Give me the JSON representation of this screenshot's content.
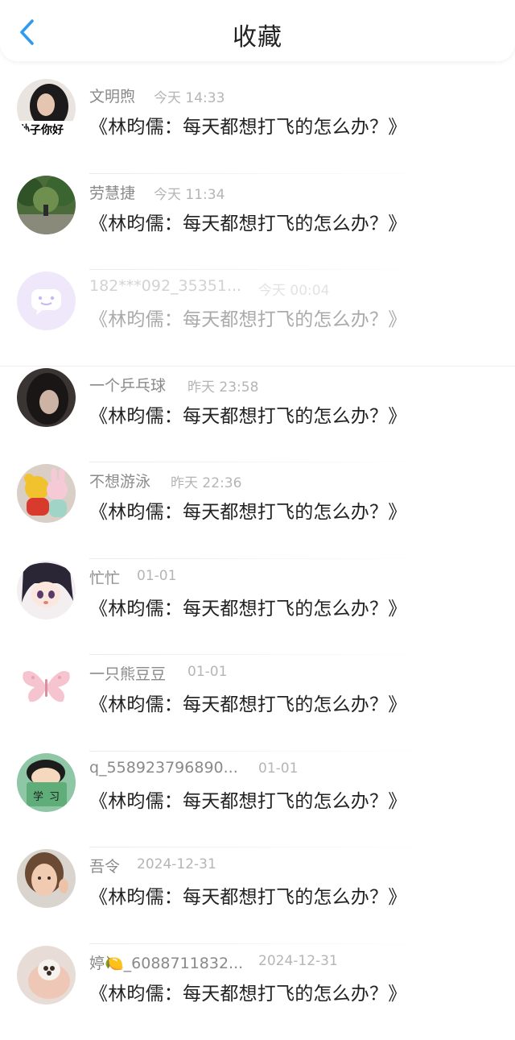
{
  "header": {
    "title": "收藏"
  },
  "messages": [
    {
      "name": "文明煦",
      "time": "今天 14:33",
      "content": "《林昀儒：每天都想打飞的怎么办？》",
      "avatar_icon": "woman-portrait-avatar"
    },
    {
      "name": "劳慧捷",
      "time": "今天 11:34",
      "content": "《林昀儒：每天都想打飞的怎么办？》",
      "avatar_icon": "forest-landscape-avatar"
    },
    {
      "name": "182***092_35351...",
      "time": "今天 00:04",
      "content": "《林昀儒：每天都想打飞的怎么办？》",
      "avatar_icon": "default-chat-bubble-avatar"
    },
    {
      "name": "一个乒乓球",
      "time": "昨天 23:58",
      "content": "《林昀儒：每天都想打飞的怎么办？》",
      "avatar_icon": "dark-portrait-avatar"
    },
    {
      "name": "不想游泳",
      "time": "昨天 22:36",
      "content": "《林昀儒：每天都想打飞的怎么办？》",
      "avatar_icon": "plush-toys-avatar"
    },
    {
      "name": "忙忙",
      "time": "01-01",
      "content": "《林昀儒：每天都想打飞的怎么办？》",
      "avatar_icon": "anime-girl-avatar"
    },
    {
      "name": "一只熊豆豆",
      "time": "01-01",
      "content": "《林昀儒：每天都想打飞的怎么办？》",
      "avatar_icon": "pink-butterfly-avatar"
    },
    {
      "name": "q_558923796890...",
      "time": "01-01",
      "content": "《林昀儒：每天都想打飞的怎么办？》",
      "avatar_icon": "cartoon-boy-book-avatar"
    },
    {
      "name": "吾令",
      "time": "2024-12-31",
      "content": "《林昀儒：每天都想打飞的怎么办？》",
      "avatar_icon": "child-portrait-avatar"
    },
    {
      "name": "婷🍋_6088711832...",
      "time": "2024-12-31",
      "content": "《林昀儒：每天都想打飞的怎么办？》",
      "avatar_icon": "cat-paw-avatar"
    }
  ],
  "colors": {
    "accent": "#2f9bf0",
    "title": "#222222",
    "name": "#8a8a8a",
    "time": "#b5b5b5"
  }
}
